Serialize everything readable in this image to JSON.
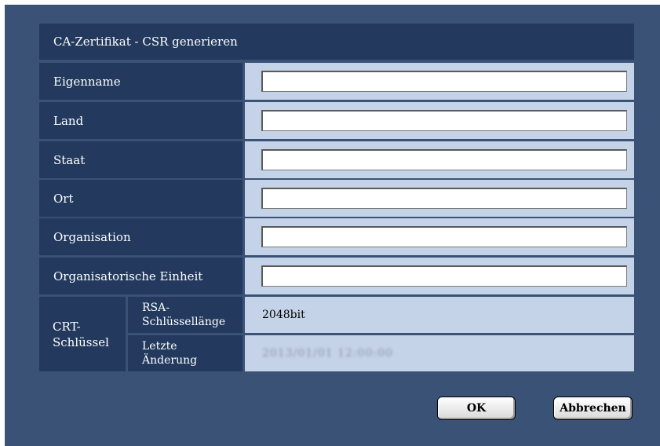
{
  "dialog": {
    "title": "CA-Zertifikat - CSR generieren"
  },
  "fields": [
    {
      "label": "Eigenname",
      "value": ""
    },
    {
      "label": "Land",
      "value": ""
    },
    {
      "label": "Staat",
      "value": ""
    },
    {
      "label": "Ort",
      "value": ""
    },
    {
      "label": "Organisation",
      "value": ""
    },
    {
      "label": "Organisatorische Einheit",
      "value": ""
    }
  ],
  "crt_key": {
    "label_line1": "CRT-",
    "label_line2": "Schlüssel",
    "rsa_label_line1": "RSA-",
    "rsa_label_line2": "Schlüssellänge",
    "rsa_value": "2048bit",
    "modified_label_line1": "Letzte",
    "modified_label_line2": "Änderung",
    "modified_value": "2013/01/01 12:00:00"
  },
  "buttons": {
    "ok_label": "OK",
    "cancel_label": "Abbrechen"
  }
}
